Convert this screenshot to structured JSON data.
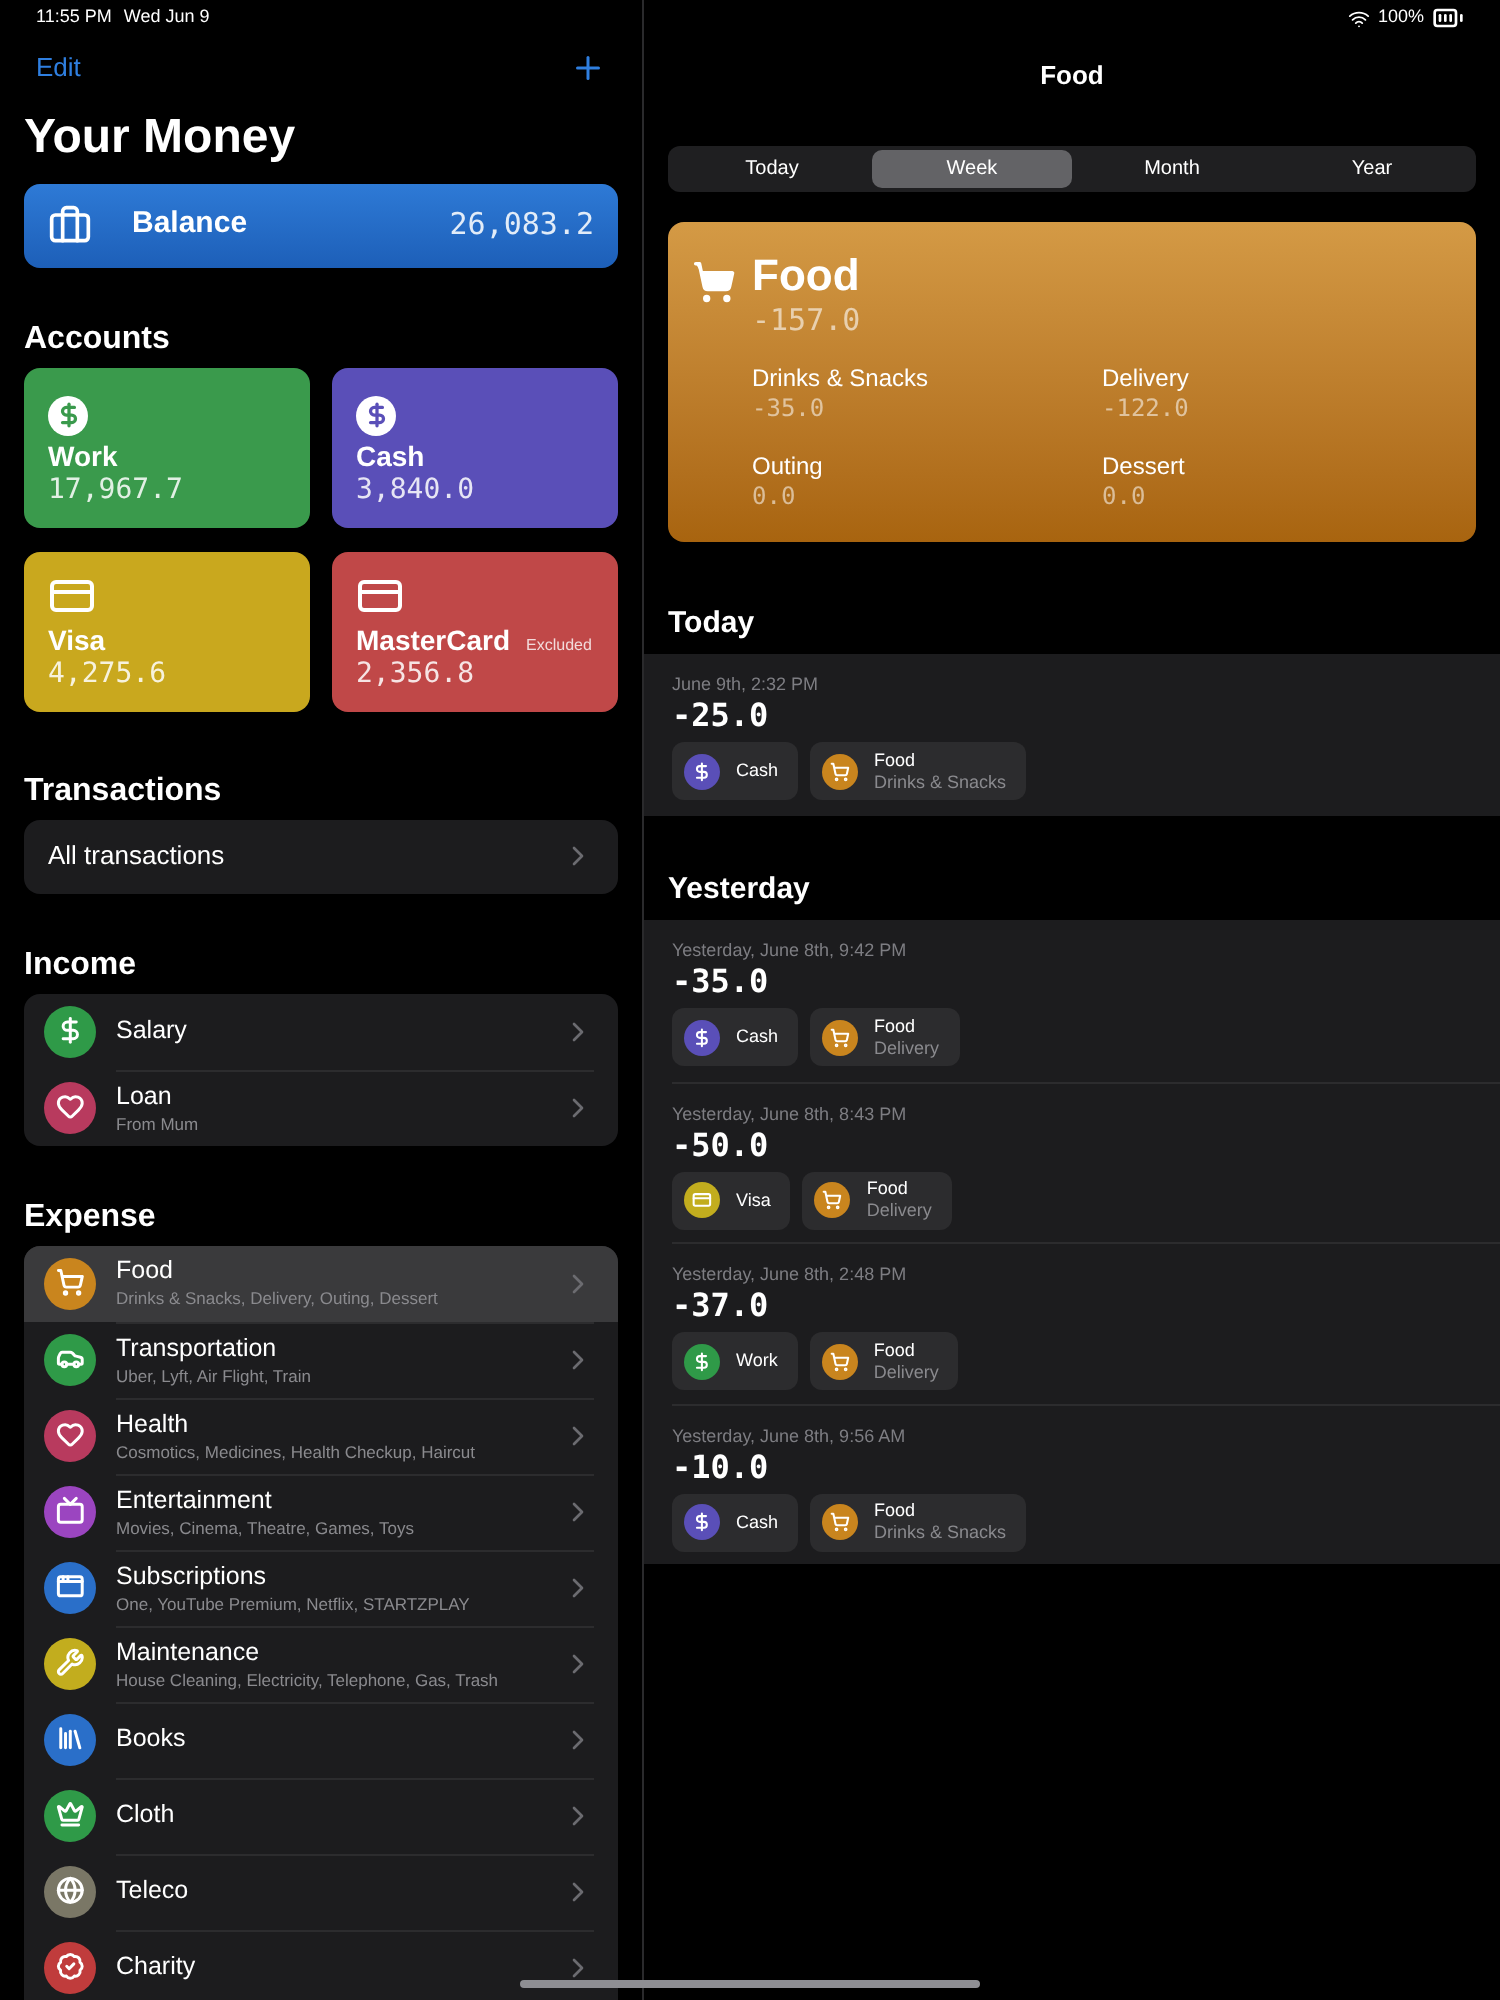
{
  "status_bar": {
    "time": "11:55 PM",
    "date": "Wed Jun 9",
    "battery": "100%"
  },
  "sidebar": {
    "edit": "Edit",
    "title": "Your Money",
    "balance": {
      "label": "Balance",
      "amount": "26,083.2"
    },
    "accounts_header": "Accounts",
    "accounts": [
      {
        "name": "Work",
        "amount": "17,967.7",
        "kind": "cash",
        "color": "#3a9a4c"
      },
      {
        "name": "Cash",
        "amount": "3,840.0",
        "kind": "cash",
        "color": "#5a4fb8"
      },
      {
        "name": "Visa",
        "amount": "4,275.6",
        "kind": "card",
        "color": "#c9a81e"
      },
      {
        "name": "MasterCard",
        "amount": "2,356.8",
        "kind": "card",
        "color": "#c04848",
        "badge": "Excluded"
      }
    ],
    "transactions_header": "Transactions",
    "all_transactions": "All transactions",
    "income_header": "Income",
    "income": [
      {
        "name": "Salary",
        "color": "#2f9a48"
      },
      {
        "name": "Loan",
        "subtitle": "From Mum",
        "color": "#b83a5e"
      }
    ],
    "expense_header": "Expense",
    "expense": [
      {
        "name": "Food",
        "subtitle": "Drinks & Snacks, Delivery, Outing, Dessert",
        "color": "#c9851e",
        "selected": true
      },
      {
        "name": "Transportation",
        "subtitle": "Uber, Lyft, Air Flight, Train",
        "color": "#2f9a48",
        "selected": false
      },
      {
        "name": "Health",
        "subtitle": "Cosmotics, Medicines, Health Checkup, Haircut",
        "color": "#b83a5e",
        "selected": false
      },
      {
        "name": "Entertainment",
        "subtitle": "Movies, Cinema, Theatre, Games, Toys",
        "color": "#9b45c0",
        "selected": false
      },
      {
        "name": "Subscriptions",
        "subtitle": " One, YouTube Premium, Netflix, STARTZPLAY",
        "color": "#2a6fc9",
        "selected": false
      },
      {
        "name": "Maintenance",
        "subtitle": "House Cleaning, Electricity, Telephone, Gas, Trash",
        "color": "#c2ad1e",
        "selected": false
      },
      {
        "name": "Books",
        "color": "#2a6fc9",
        "selected": false
      },
      {
        "name": "Cloth",
        "color": "#2f9a48",
        "selected": false
      },
      {
        "name": "Teleco",
        "color": "#7a7766",
        "selected": false
      },
      {
        "name": "Charity",
        "color": "#c03c3c",
        "selected": false
      }
    ]
  },
  "detail": {
    "title": "Food",
    "tabs": [
      {
        "label": "Today",
        "selected": false
      },
      {
        "label": "Week",
        "selected": true
      },
      {
        "label": "Month",
        "selected": false
      },
      {
        "label": "Year",
        "selected": false
      }
    ],
    "summary": {
      "name": "Food",
      "amount": "-157.0",
      "subcategories": [
        {
          "name": "Drinks & Snacks",
          "amount": "-35.0"
        },
        {
          "name": "Delivery",
          "amount": "-122.0"
        },
        {
          "name": "Outing",
          "amount": "0.0"
        },
        {
          "name": "Dessert",
          "amount": "0.0"
        }
      ]
    },
    "sections": [
      {
        "title": "Today",
        "transactions": [
          {
            "date": "June 9th, 2:32 PM",
            "amount": "-25.0",
            "account": {
              "name": "Cash",
              "kind": "cash",
              "color": "#5a4fb8"
            },
            "category": {
              "name": "Food",
              "subcategory": "Drinks & Snacks"
            }
          }
        ]
      },
      {
        "title": "Yesterday",
        "transactions": [
          {
            "date": "Yesterday, June 8th, 9:42 PM",
            "amount": "-35.0",
            "account": {
              "name": "Cash",
              "kind": "cash",
              "color": "#5a4fb8"
            },
            "category": {
              "name": "Food",
              "subcategory": "Delivery"
            }
          },
          {
            "date": "Yesterday, June 8th, 8:43 PM",
            "amount": "-50.0",
            "account": {
              "name": "Visa",
              "kind": "card",
              "color": "#c2ad1e"
            },
            "category": {
              "name": "Food",
              "subcategory": "Delivery"
            }
          },
          {
            "date": "Yesterday, June 8th, 2:48 PM",
            "amount": "-37.0",
            "account": {
              "name": "Work",
              "kind": "cash",
              "color": "#2f9a48"
            },
            "category": {
              "name": "Food",
              "subcategory": "Delivery"
            }
          },
          {
            "date": "Yesterday, June 8th, 9:56 AM",
            "amount": "-10.0",
            "account": {
              "name": "Cash",
              "kind": "cash",
              "color": "#5a4fb8"
            },
            "category": {
              "name": "Food",
              "subcategory": "Drinks & Snacks"
            }
          }
        ]
      }
    ]
  }
}
